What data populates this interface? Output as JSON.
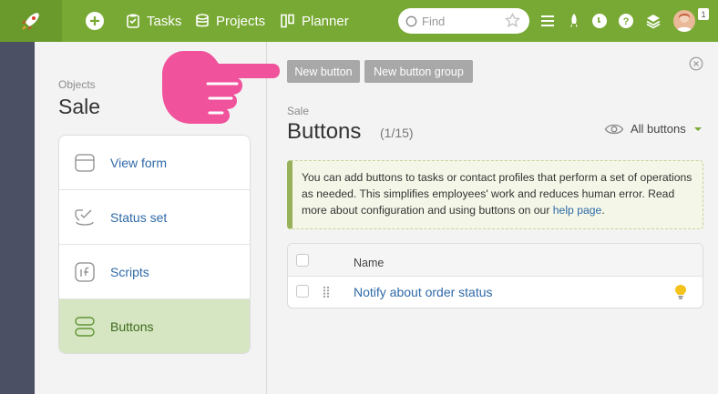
{
  "topbar": {
    "nav": [
      {
        "label": "Tasks"
      },
      {
        "label": "Projects"
      },
      {
        "label": "Planner"
      }
    ],
    "search_placeholder": "Find",
    "notifications_count": "1"
  },
  "objects": {
    "subtitle": "Objects",
    "title": "Sale",
    "items": [
      {
        "label": "View form"
      },
      {
        "label": "Status set"
      },
      {
        "label": "Scripts"
      },
      {
        "label": "Buttons"
      }
    ]
  },
  "toolbar": {
    "new_button": "New button",
    "new_button_group": "New button group"
  },
  "main": {
    "subtitle": "Sale",
    "title": "Buttons",
    "count": "(1/15)",
    "filter_label": "All buttons",
    "info_text": "You can add buttons to tasks or contact profiles that perform a set of operations as needed. This simplifies employees' work and reduces human error. Read more about configuration and using buttons on our ",
    "info_link": "help page",
    "info_end": ".",
    "table": {
      "header_name": "Name",
      "rows": [
        {
          "name": "Notify about order status"
        }
      ]
    }
  },
  "colors": {
    "topbar": "#78a934",
    "accent_link": "#2f6aa8",
    "active_item_bg": "#d6e6c2",
    "hand": "#f0529c"
  }
}
